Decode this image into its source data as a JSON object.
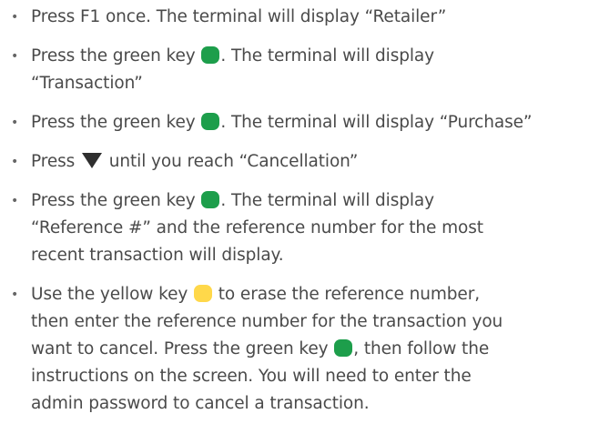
{
  "colors": {
    "green_key": "#1d9e4b",
    "yellow_key": "#ffd84a",
    "text": "#4a4a4a",
    "arrow": "#2f2f2f"
  },
  "icons": {
    "green_key": "green-key-icon",
    "yellow_key": "yellow-key-icon",
    "down_arrow": "down-arrow-icon"
  },
  "steps": [
    {
      "text_1": "Press F1 once. The terminal will display “Retailer”"
    },
    {
      "text_1": "Press the green key ",
      "text_2": ". The terminal will display",
      "text_3": "“Transaction”"
    },
    {
      "text_1": "Press the green key ",
      "text_2": ". The terminal will display “Purchase”"
    },
    {
      "text_1": "Press ",
      "text_2": " until you reach “Cancellation”"
    },
    {
      "text_1": "Press the green key ",
      "text_2": ". The terminal will display",
      "text_3": "“Reference #” and the reference number for the most",
      "text_4": "recent transaction will display."
    },
    {
      "text_1": "Use the yellow key ",
      "text_2": " to erase the reference number,",
      "text_3": "then enter the reference number for the transaction you",
      "text_4": "want to cancel. Press the green key ",
      "text_5": ", then follow the",
      "text_6": "instructions on the screen. You will need to enter the",
      "text_7": "admin password to cancel a transaction."
    }
  ]
}
